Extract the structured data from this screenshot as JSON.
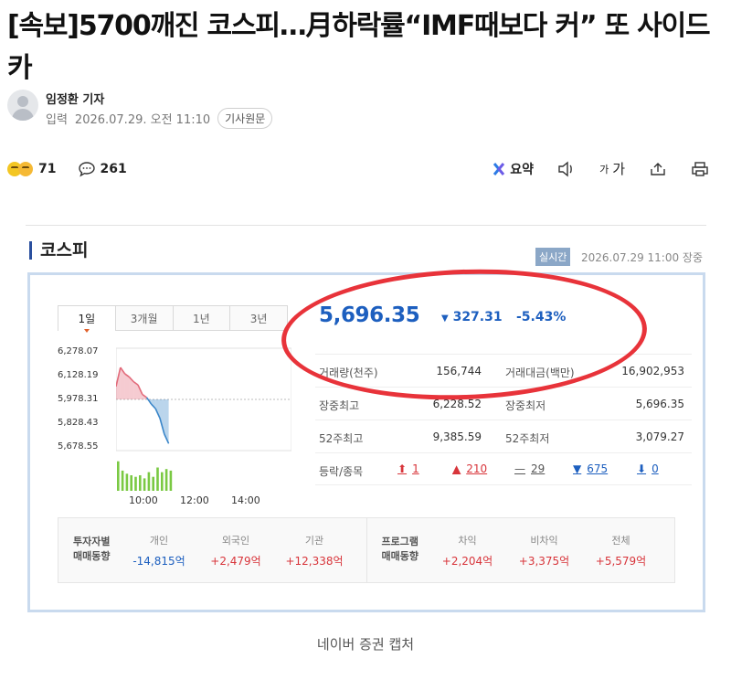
{
  "article": {
    "headline": "[속보]5700깨진 코스피…月하락률“IMF때보다 커” 또 사이드카",
    "reporter": "임정환 기자",
    "date_label": "입력",
    "date": "2026.07.29. 오전 11:10",
    "origin_button": "기사원문"
  },
  "stats": {
    "reactions": "71",
    "comments": "261"
  },
  "toolbar": {
    "summary_label": "요약",
    "font_small": "가",
    "font_big": "가",
    "icons": [
      "ai-summary-icon",
      "speaker-icon",
      "font-size-icon",
      "share-icon",
      "print-icon"
    ]
  },
  "capture": {
    "title": "코스피",
    "live_badge": "실시간",
    "datetime": "2026.07.29 11:00 장중",
    "tabs": [
      "1일",
      "3개월",
      "1년",
      "3년"
    ],
    "price": "5,696.35",
    "change": "327.31",
    "change_pct": "-5.43%",
    "rows": [
      {
        "label1": "거래량(천주)",
        "value1": "156,744",
        "label2": "거래대금(백만)",
        "value2": "16,902,953"
      },
      {
        "label1": "장중최고",
        "value1": "6,228.52",
        "label2": "장중최저",
        "value2": "5,696.35"
      },
      {
        "label1": "52주최고",
        "value1": "9,385.59",
        "label2": "52주최저",
        "value2": "3,079.27"
      }
    ],
    "updown_label": "등락/종목",
    "updown": [
      {
        "arrow": "⬆",
        "value": "1",
        "color": "#d8353b"
      },
      {
        "arrow": "▲",
        "value": "210",
        "color": "#d8353b"
      },
      {
        "arrow": "—",
        "value": "29",
        "color": "#555555"
      },
      {
        "arrow": "▼",
        "value": "675",
        "color": "#1d5fbf"
      },
      {
        "arrow": "⬇",
        "value": "0",
        "color": "#1d5fbf"
      }
    ],
    "flows": {
      "investor_head": [
        "투자자별",
        "매매동향"
      ],
      "investor": [
        {
          "name": "개인",
          "value": "-14,815억",
          "sign": "neg"
        },
        {
          "name": "외국인",
          "value": "+2,479억",
          "sign": "pos"
        },
        {
          "name": "기관",
          "value": "+12,338억",
          "sign": "pos"
        }
      ],
      "program_head": [
        "프로그램",
        "매매동향"
      ],
      "program": [
        {
          "name": "차익",
          "value": "+2,204억",
          "sign": "pos"
        },
        {
          "name": "비차익",
          "value": "+3,375억",
          "sign": "pos"
        },
        {
          "name": "전체",
          "value": "+5,579억",
          "sign": "pos"
        }
      ]
    }
  },
  "chart_data": {
    "type": "line",
    "y_ticks": [
      "6,278.07",
      "6,128.19",
      "5,978.31",
      "5,828.43",
      "5,678.55"
    ],
    "ylim": [
      5678.55,
      6278.07
    ],
    "reference": 5978.31,
    "x_ticks": [
      "10:00",
      "12:00",
      "14:00"
    ],
    "x_minutes": [
      0,
      10,
      20,
      30,
      40,
      50,
      60,
      70,
      80,
      90,
      100,
      110,
      120
    ],
    "series": [
      {
        "values": [
          6060,
          6180,
          6140,
          6120,
          6090,
          6070,
          6010,
          5990,
          5950,
          5920,
          5860,
          5760,
          5700
        ]
      }
    ],
    "volume": [
      38,
      26,
      22,
      20,
      18,
      20,
      16,
      24,
      18,
      30,
      24,
      28,
      26
    ],
    "colors": {
      "up": "#e26a7a",
      "down": "#3a86c9",
      "volume": "#7ac943"
    }
  },
  "caption": "네이버 증권 캡처"
}
